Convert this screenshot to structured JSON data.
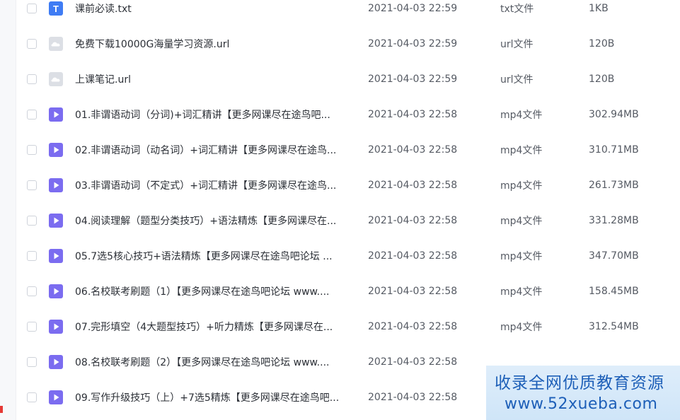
{
  "files": [
    {
      "name": "课前必读.txt",
      "date": "2021-04-03 22:59",
      "type": "txt文件",
      "size": "1KB",
      "icon": "text-file-icon"
    },
    {
      "name": "免费下载10000G海量学习资源.url",
      "date": "2021-04-03 22:59",
      "type": "url文件",
      "size": "120B",
      "icon": "url-file-icon"
    },
    {
      "name": "上课笔记.url",
      "date": "2021-04-03 22:59",
      "type": "url文件",
      "size": "120B",
      "icon": "url-file-icon"
    },
    {
      "name": "01.非谓语动词（分词)+词汇精讲【更多网课尽在途鸟吧...",
      "date": "2021-04-03 22:58",
      "type": "mp4文件",
      "size": "302.94MB",
      "icon": "video-file-icon"
    },
    {
      "name": "02.非谓语动词（动名词）+词汇精讲【更多网课尽在途鸟...",
      "date": "2021-04-03 22:58",
      "type": "mp4文件",
      "size": "310.71MB",
      "icon": "video-file-icon"
    },
    {
      "name": "03.非谓语动词（不定式）+词汇精讲【更多网课尽在途鸟...",
      "date": "2021-04-03 22:58",
      "type": "mp4文件",
      "size": "261.73MB",
      "icon": "video-file-icon"
    },
    {
      "name": "04.阅读理解（题型分类技巧）+语法精炼【更多网课尽在...",
      "date": "2021-04-03 22:58",
      "type": "mp4文件",
      "size": "331.28MB",
      "icon": "video-file-icon"
    },
    {
      "name": "05.7选5核心技巧+语法精炼【更多网课尽在途鸟吧论坛 ...",
      "date": "2021-04-03 22:58",
      "type": "mp4文件",
      "size": "347.70MB",
      "icon": "video-file-icon"
    },
    {
      "name": "06.名校联考刷题（1）【更多网课尽在途鸟吧论坛 www....",
      "date": "2021-04-03 22:58",
      "type": "mp4文件",
      "size": "158.45MB",
      "icon": "video-file-icon"
    },
    {
      "name": "07.完形填空（4大题型技巧）+听力精炼【更多网课尽在...",
      "date": "2021-04-03 22:58",
      "type": "mp4文件",
      "size": "312.54MB",
      "icon": "video-file-icon"
    },
    {
      "name": "08.名校联考刷题（2）【更多网课尽在途鸟吧论坛 www....",
      "date": "2021-04-03 22:58",
      "type": "",
      "size": "",
      "icon": "video-file-icon"
    },
    {
      "name": "09.写作升级技巧（上）+7选5精炼【更多网课尽在途鸟吧...",
      "date": "2021-04-03 22:58",
      "type": "",
      "size": "",
      "icon": "video-file-icon"
    }
  ],
  "watermark": {
    "line1": "收录全网优质教育资源",
    "line2": "www.52xueba.com"
  },
  "colors": {
    "text_file_icon": "#3f7cf4",
    "url_file_icon": "#dcdfe5",
    "video_file_icon": "#7b6cf0",
    "watermark_text": "#1d5fb8"
  }
}
